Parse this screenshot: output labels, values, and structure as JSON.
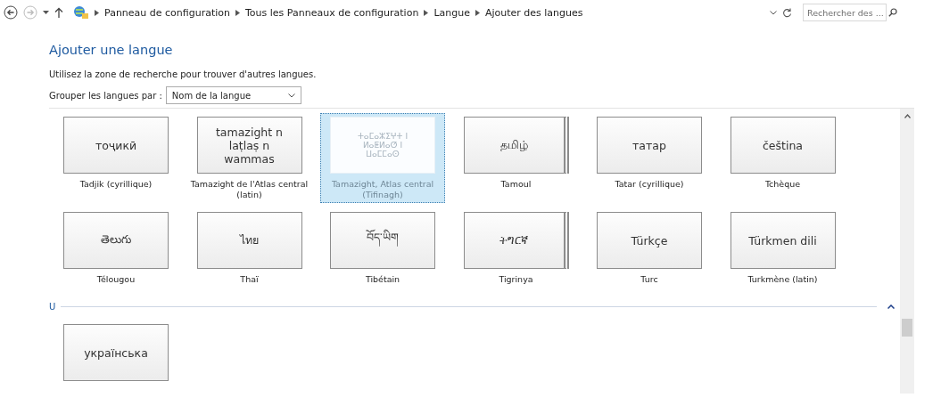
{
  "address_bar": {
    "breadcrumbs": [
      "Panneau de configuration",
      "Tous les Panneaux de configuration",
      "Langue",
      "Ajouter des langues"
    ],
    "back_disabled": false,
    "forward_disabled": true
  },
  "search": {
    "placeholder": "Rechercher des ..."
  },
  "page": {
    "title": "Ajouter une langue",
    "hint": "Utilisez la zone de recherche pour trouver d'autres langues.",
    "group_label": "Grouper les langues par :",
    "group_value": "Nom de la langue"
  },
  "languages": [
    {
      "native": "тоҷикӣ",
      "name": "Tadjik (cyrillique)",
      "selected": false,
      "multiple": false
    },
    {
      "native": "tamazight n laṭlaṣ n wammas",
      "name": "Tamazight de l'Atlas central (latin)",
      "selected": false,
      "multiple": false
    },
    {
      "native": "ⵜⴰⵎⴰⵣⵉⵖⵜ ⵏ ⵍⴰⵟⵍⴰⵚ ⵏ ⵡⴰⵎⵎⴰⵙ",
      "name": "Tamazight, Atlas central (Tifinagh)",
      "selected": true,
      "multiple": false
    },
    {
      "native": "தமிழ்",
      "name": "Tamoul",
      "selected": false,
      "multiple": true
    },
    {
      "native": "татар",
      "name": "Tatar (cyrillique)",
      "selected": false,
      "multiple": false
    },
    {
      "native": "čeština",
      "name": "Tchèque",
      "selected": false,
      "multiple": false
    },
    {
      "native": "తెలుగు",
      "name": "Télougou",
      "selected": false,
      "multiple": false
    },
    {
      "native": "ไทย",
      "name": "Thaï",
      "selected": false,
      "multiple": false
    },
    {
      "native": "བོད་ཡིག",
      "name": "Tibétain",
      "selected": false,
      "multiple": false
    },
    {
      "native": "ትግርኛ",
      "name": "Tigrinya",
      "selected": false,
      "multiple": true
    },
    {
      "native": "Türkçe",
      "name": "Turc",
      "selected": false,
      "multiple": false
    },
    {
      "native": "Türkmen dili",
      "name": "Turkmène (latin)",
      "selected": false,
      "multiple": false
    }
  ],
  "groups": [
    {
      "letter": "U",
      "expanded": true,
      "languages": [
        {
          "native": "українська",
          "selected": false,
          "multiple": false
        }
      ]
    }
  ]
}
